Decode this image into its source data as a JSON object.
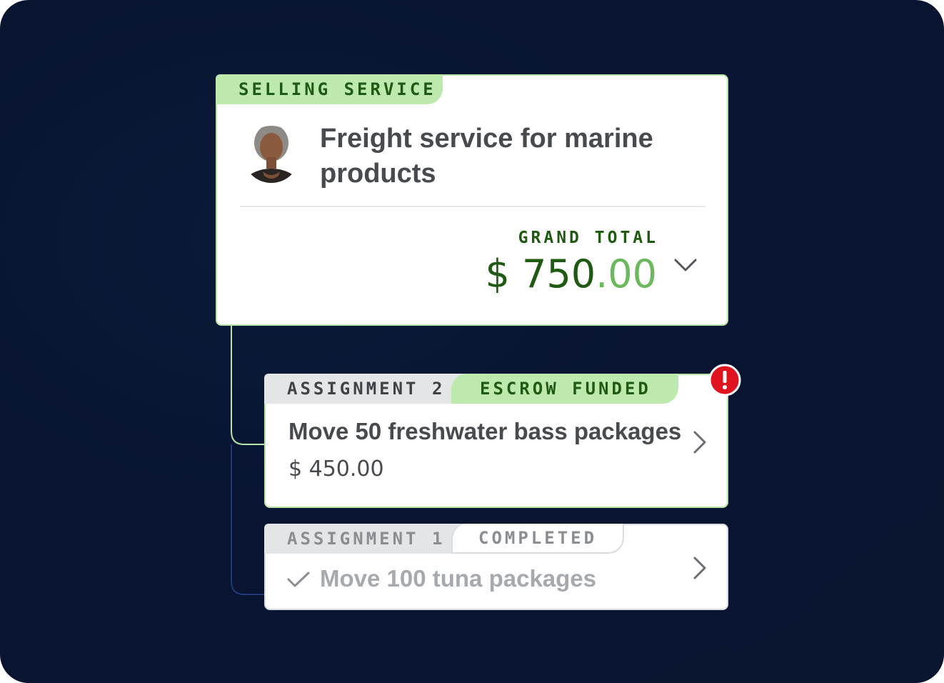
{
  "selling_service": {
    "tab_label": "SELLING SERVICE",
    "title": "Freight service for marine products",
    "grand_total_label": "GRAND TOTAL",
    "grand_total_currency": "$",
    "grand_total_whole": "750",
    "grand_total_cents": ".00",
    "expand_icon": "chevron-down-icon",
    "avatar": "avatar-photo"
  },
  "assignments": [
    {
      "label": "ASSIGNMENT 2",
      "status": "ESCROW FUNDED",
      "title": "Move 50 freshwater bass packages",
      "amount": "$ 450.00",
      "alert_icon": "exclamation-alert-icon",
      "open_icon": "chevron-right-icon"
    },
    {
      "label": "ASSIGNMENT 1",
      "status": "COMPLETED",
      "title": "Move 100 tuna packages",
      "status_icon": "checkmark-icon",
      "open_icon": "chevron-right-icon"
    }
  ],
  "colors": {
    "background": "#081430",
    "accent_green": "#1f5a12",
    "light_green": "#bde9ad",
    "cents_green": "#6cb85c",
    "alert_red": "#e0141e",
    "muted_gray": "#a6a9ad",
    "connector_blue": "#1f3a7a"
  }
}
